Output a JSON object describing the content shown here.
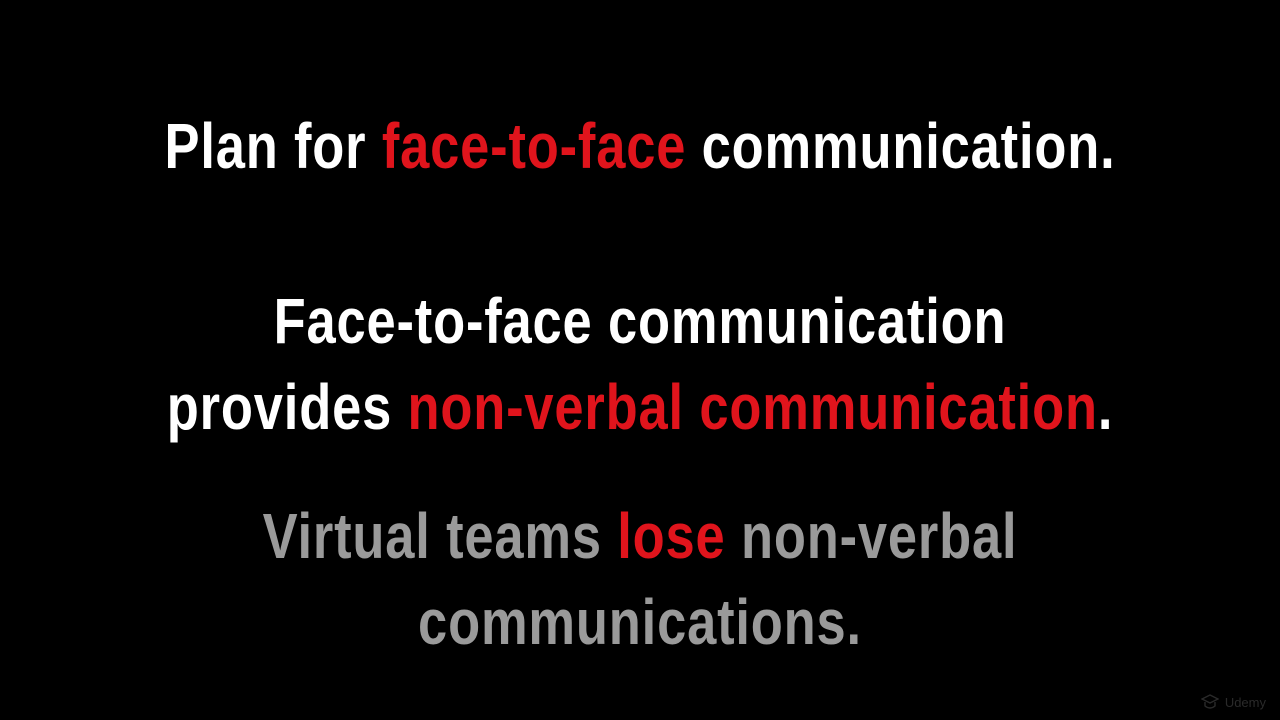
{
  "slide": {
    "heading": {
      "before": "Plan for ",
      "highlight": "face-to-face",
      "after": " communication."
    },
    "statement": {
      "line1": "Face-to-face communication",
      "line2_before": "provides ",
      "line2_highlight": "non-verbal communication",
      "line2_after": "."
    },
    "note": {
      "line1_before": "Virtual teams ",
      "line1_highlight": "lose",
      "line1_after": " non-verbal",
      "line2": "communications."
    }
  },
  "watermark": {
    "text": "Udemy",
    "icon": "udemy-logo-icon"
  },
  "colors": {
    "background": "#000000",
    "primary_text": "#ffffff",
    "secondary_text": "#9a9a9a",
    "highlight": "#e0141c"
  }
}
